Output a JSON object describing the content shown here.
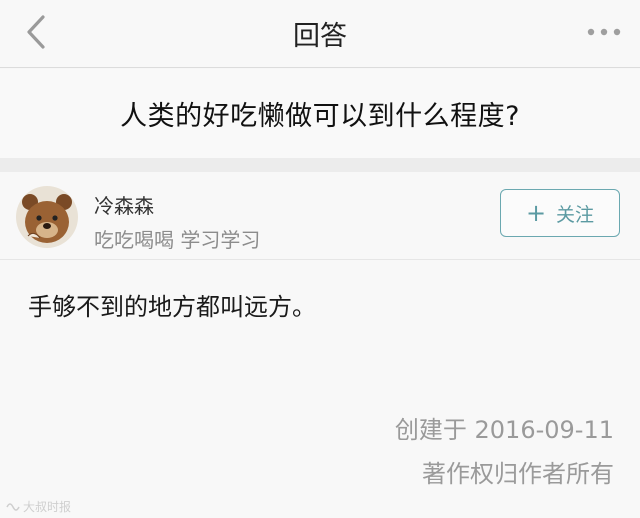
{
  "nav": {
    "title": "回答",
    "back_icon": "chevron-left-icon",
    "more_icon": "more-dots-icon"
  },
  "question": {
    "title": "人类的好吃懒做可以到什么程度?"
  },
  "answer": {
    "author": {
      "name": "冷森森",
      "bio": "吃吃喝喝 学习学习",
      "avatar_icon": "bear-avatar"
    },
    "follow_button": {
      "label": "关注",
      "icon": "plus-icon"
    },
    "body": "手够不到的地方都叫远方。",
    "created": "创建于 2016-09-11",
    "copyright": "著作权归作者所有"
  },
  "watermark": "大叔时报",
  "colors": {
    "accent": "#5b9aa2",
    "muted_text": "#9a9a9a",
    "background": "#f8f8f8"
  }
}
